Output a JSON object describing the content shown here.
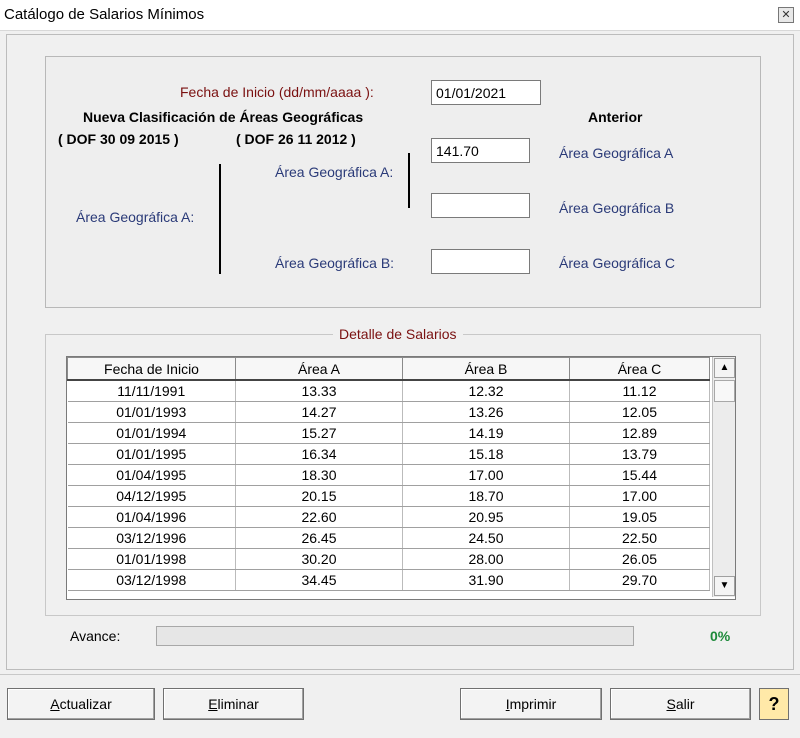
{
  "window": {
    "title": "Catálogo de Salarios Mínimos",
    "close_glyph": "✕"
  },
  "header": {
    "fecha_label": "Fecha de Inicio (dd/mm/aaaa ):",
    "fecha_value": "01/01/2021",
    "nueva_clasificacion": "Nueva Clasificación de Áreas Geográficas",
    "dof_2015": "( DOF 30 09 2015 )",
    "dof_2012": "( DOF 26 11 2012 )",
    "anterior": "Anterior",
    "area_a_left": "Área Geográfica A:",
    "area_a_mid": "Área Geográfica A:",
    "area_b_mid": "Área Geográfica B:",
    "anterior_a": "Área Geográfica A",
    "anterior_b": "Área Geográfica B",
    "anterior_c": "Área Geográfica C",
    "input_a": "141.70",
    "input_b": "",
    "input_c": ""
  },
  "detail": {
    "title": "Detalle de Salarios",
    "columns": [
      "Fecha de Inicio",
      "Área A",
      "Área B",
      "Área C"
    ],
    "rows": [
      [
        "11/11/1991",
        "13.33",
        "12.32",
        "11.12"
      ],
      [
        "01/01/1993",
        "14.27",
        "13.26",
        "12.05"
      ],
      [
        "01/01/1994",
        "15.27",
        "14.19",
        "12.89"
      ],
      [
        "01/01/1995",
        "16.34",
        "15.18",
        "13.79"
      ],
      [
        "01/04/1995",
        "18.30",
        "17.00",
        "15.44"
      ],
      [
        "04/12/1995",
        "20.15",
        "18.70",
        "17.00"
      ],
      [
        "01/04/1996",
        "22.60",
        "20.95",
        "19.05"
      ],
      [
        "03/12/1996",
        "26.45",
        "24.50",
        "22.50"
      ],
      [
        "01/01/1998",
        "30.20",
        "28.00",
        "26.05"
      ],
      [
        "03/12/1998",
        "34.45",
        "31.90",
        "29.70"
      ]
    ]
  },
  "progress": {
    "label": "Avance:",
    "value": 0,
    "percent_text": "0%"
  },
  "buttons": {
    "actualizar_key": "A",
    "actualizar_rest": "ctualizar",
    "eliminar_key": "E",
    "eliminar_rest": "liminar",
    "imprimir_key": "I",
    "imprimir_rest": "mprimir",
    "salir_key": "S",
    "salir_rest": "alir",
    "help_glyph": "?"
  },
  "icons": {
    "close": "close-icon",
    "scroll_up": "scroll-up-icon",
    "scroll_down": "scroll-down-icon",
    "help": "help-icon"
  },
  "colors": {
    "label_red": "#7a1010",
    "label_blue": "#2a3a78",
    "percent_green": "#1d8a3a",
    "help_bg": "#ffe9a8"
  }
}
